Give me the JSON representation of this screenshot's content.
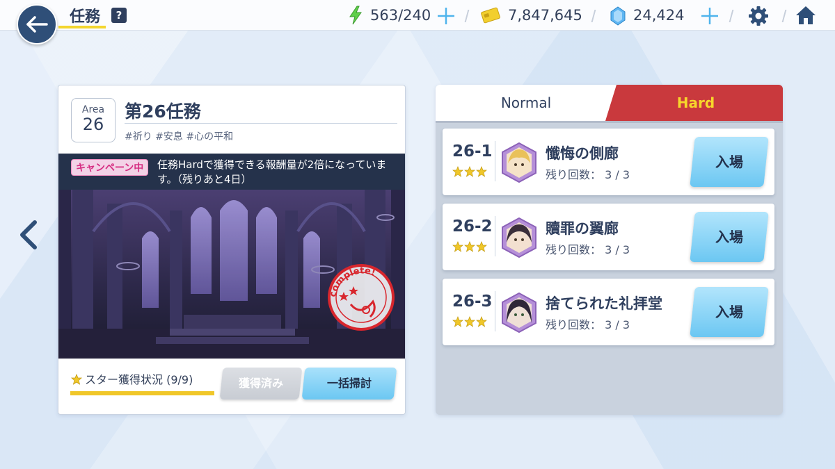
{
  "header": {
    "title": "任務",
    "help_label": "?",
    "stamina": "563/240",
    "gold": "7,847,645",
    "gems": "24,424"
  },
  "mission": {
    "area_label": "Area",
    "area_number": "26",
    "title": "第26任務",
    "tags": "#祈り #安息 #心の平和",
    "campaign_badge": "キャンペーン中",
    "campaign_text": "任務Hardで獲得できる報酬量が2倍になっています。（残りあと4日）",
    "stamp_text": "complete!",
    "star_status": "スター獲得状況 (9/9)",
    "star_progress": 1.0,
    "obtained_button": "獲得済み",
    "sweep_button": "一括掃討"
  },
  "tabs": {
    "normal": "Normal",
    "hard": "Hard",
    "active": "Hard"
  },
  "stages": [
    {
      "number": "26-1",
      "name": "懺悔の側廊",
      "remaining": "残り回数： 3 / 3",
      "stars": 3,
      "enter_label": "入場"
    },
    {
      "number": "26-2",
      "name": "贖罪の翼廊",
      "remaining": "残り回数： 3 / 3",
      "stars": 3,
      "enter_label": "入場"
    },
    {
      "number": "26-3",
      "name": "捨てられた礼拝堂",
      "remaining": "残り回数： 3 / 3",
      "stars": 3,
      "enter_label": "入場"
    }
  ],
  "colors": {
    "accent_dark": "#2f3f5e",
    "hard_tab": "#c9393d",
    "hard_tab_text": "#f7d62b",
    "enter_button": "#6cc7f2",
    "star": "#f0c729",
    "campaign_pink": "#d62e82"
  }
}
